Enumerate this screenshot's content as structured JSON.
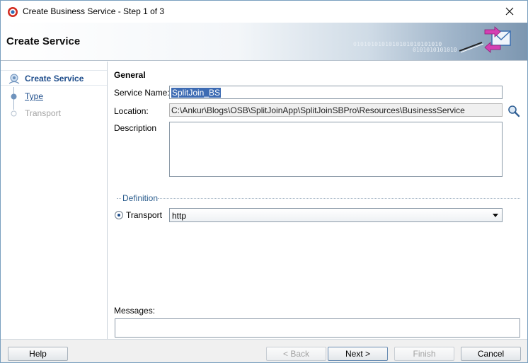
{
  "window": {
    "title": "Create Business Service - Step 1 of 3"
  },
  "banner": {
    "title": "Create Service",
    "binary_1": "0101010101010101010101010",
    "binary_2": "0101010101010"
  },
  "steps": [
    {
      "label": "Create Service",
      "state": "active"
    },
    {
      "label": "Type",
      "state": "link"
    },
    {
      "label": "Transport",
      "state": "disabled"
    }
  ],
  "general": {
    "section_title": "General",
    "service_name_label": "Service Name:",
    "service_name_value": "SplitJoin_BS",
    "location_label": "Location:",
    "location_value": "C:\\Ankur\\Blogs\\OSB\\SplitJoinApp\\SplitJoinSBPro\\Resources\\BusinessService",
    "description_label": "Description"
  },
  "definition": {
    "group_label": "Definition",
    "transport_label": "Transport",
    "transport_value": "http"
  },
  "messages": {
    "label": "Messages:"
  },
  "buttons": {
    "help": "Help",
    "back": "< Back",
    "next": "Next >",
    "finish": "Finish",
    "cancel": "Cancel"
  },
  "colors": {
    "accent": "#1f4e8c",
    "selection": "#3d6bb3",
    "footer_bg": "#f0f0f0"
  },
  "icons": {
    "app": "oracle-app-icon",
    "close": "close-icon",
    "banner": "envelope-arrows-icon",
    "browse": "magnifier-icon"
  }
}
